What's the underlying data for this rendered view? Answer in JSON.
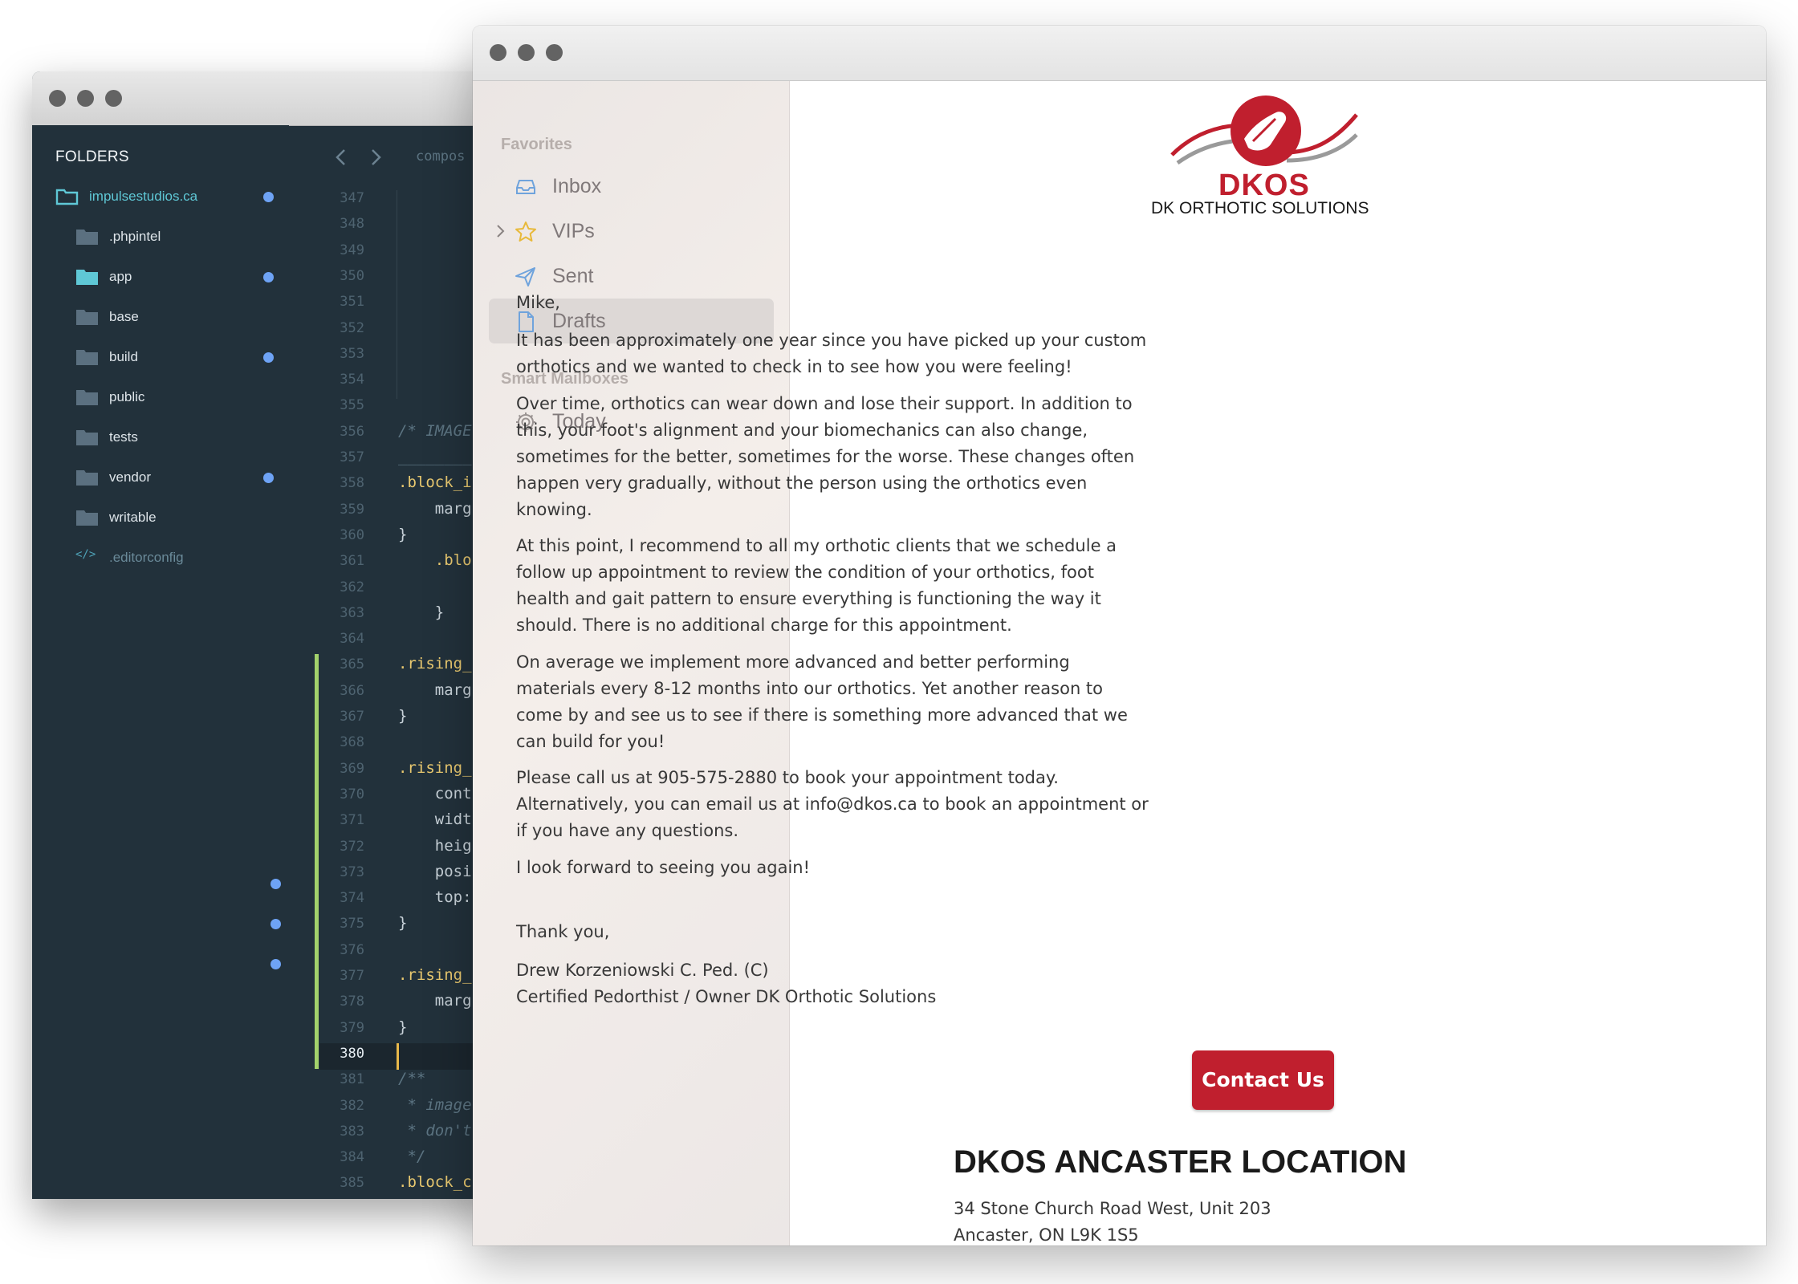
{
  "editor": {
    "folders_title": "FOLDERS",
    "tab_label": "compos",
    "tree": [
      {
        "label": "impulsestudios.ca",
        "modified": true
      },
      {
        "label": ".phpintel",
        "modified": false
      },
      {
        "label": "app",
        "modified": true
      },
      {
        "label": "base",
        "modified": false
      },
      {
        "label": "build",
        "modified": true
      },
      {
        "label": "public",
        "modified": false
      },
      {
        "label": "tests",
        "modified": false
      },
      {
        "label": "vendor",
        "modified": true
      },
      {
        "label": "writable",
        "modified": false
      },
      {
        "label": ".editorconfig",
        "modified": false
      }
    ],
    "line_numbers": [
      "347",
      "348",
      "349",
      "350",
      "351",
      "352",
      "353",
      "354",
      "355",
      "356",
      "357",
      "358",
      "359",
      "360",
      "361",
      "362",
      "363",
      "364",
      "365",
      "366",
      "367",
      "368",
      "369",
      "370",
      "371",
      "372",
      "373",
      "374",
      "375",
      "376",
      "377",
      "378",
      "379",
      "380",
      "381",
      "382",
      "383",
      "384",
      "385"
    ],
    "active_line": "380",
    "code_lines": [
      {
        "line": "356",
        "text": "/* IMAGE",
        "kind": "cmt"
      },
      {
        "line": "357",
        "text": "________",
        "kind": "cmt"
      },
      {
        "line": "358",
        "text": ".block_i",
        "kind": "sel"
      },
      {
        "line": "359",
        "text": "    marg",
        "kind": "plain"
      },
      {
        "line": "360",
        "text": "}",
        "kind": "plain"
      },
      {
        "line": "361",
        "text": "    .blo",
        "kind": "sel"
      },
      {
        "line": "362",
        "text": "        (",
        "kind": "plain"
      },
      {
        "line": "363",
        "text": "    }",
        "kind": "plain"
      },
      {
        "line": "365",
        "text": ".rising_",
        "kind": "sel"
      },
      {
        "line": "366",
        "text": "    marg",
        "kind": "plain"
      },
      {
        "line": "367",
        "text": "}",
        "kind": "plain"
      },
      {
        "line": "369",
        "text": ".rising_",
        "kind": "sel"
      },
      {
        "line": "370",
        "text": "    cont",
        "kind": "plain"
      },
      {
        "line": "371",
        "text": "    widt",
        "kind": "plain"
      },
      {
        "line": "372",
        "text": "    heig",
        "kind": "plain"
      },
      {
        "line": "373",
        "text": "    posi",
        "kind": "plain"
      },
      {
        "line": "374",
        "text": "    top:",
        "kind": "plain"
      },
      {
        "line": "375",
        "text": "}",
        "kind": "plain"
      },
      {
        "line": "377",
        "text": ".rising_",
        "kind": "sel"
      },
      {
        "line": "378",
        "text": "    marg",
        "kind": "plain"
      },
      {
        "line": "379",
        "text": "}",
        "kind": "plain"
      },
      {
        "line": "381",
        "text": "/**",
        "kind": "cmt"
      },
      {
        "line": "382",
        "text": " * image",
        "kind": "cmt"
      },
      {
        "line": "383",
        "text": " * don't",
        "kind": "cmt"
      },
      {
        "line": "384",
        "text": " */",
        "kind": "cmt"
      },
      {
        "line": "385",
        "text": ".block_c",
        "kind": "sel"
      }
    ]
  },
  "mail": {
    "sidebar": {
      "favorites_heading": "Favorites",
      "favorites": [
        {
          "label": "Inbox",
          "icon": "inbox-icon"
        },
        {
          "label": "VIPs",
          "icon": "star-icon"
        },
        {
          "label": "Sent",
          "icon": "paper-plane-icon"
        },
        {
          "label": "Drafts",
          "icon": "document-icon"
        }
      ],
      "smart_heading": "Smart Mailboxes",
      "smart": [
        {
          "label": "Today",
          "icon": "gear-icon"
        }
      ]
    },
    "message": {
      "logo_main": "DKOS",
      "logo_sub": "DK ORTHOTIC SOLUTIONS",
      "greeting": "Mike,",
      "paragraphs": [
        "It has been approximately one year since you have picked up your custom orthotics and we wanted to check in to see how you were feeling!",
        "Over time, orthotics can wear down and lose their support.  In addition to this, your foot's alignment and your biomechanics can also change, sometimes for the better, sometimes for the worse.  These changes often happen very gradually, without the person using the orthotics even knowing.",
        "At this point, I recommend to all my orthotic clients that we schedule a follow up appointment to review the condition of your orthotics, foot health and gait pattern to ensure everything is functioning the way it should. There is no additional charge for this appointment.",
        "On average we implement more advanced and better performing materials every 8-12 months into our orthotics.  Yet another reason to come by and see us to see if there is something more advanced that we can build for you!",
        "Please call us at 905-575-2880 to book your appointment today. Alternatively, you can email us at info@dkos.ca to book an appointment or if you have any questions.",
        "I look forward to seeing you again!"
      ],
      "closing": "Thank you,",
      "signature_name": "Drew Korzeniowski C. Ped. (C)",
      "signature_title": "Certified Pedorthist / Owner DK Orthotic Solutions",
      "cta_label": "Contact Us",
      "location_title": "DKOS ANCASTER LOCATION",
      "address_line1": "34 Stone Church Road West, Unit 203",
      "address_line2": "Ancaster, ON L9K 1S5"
    }
  },
  "colors": {
    "editor_bg": "#22313b",
    "accent_red": "#c01f2e",
    "modified_dot": "#6ea3f5",
    "git_gutter": "#a3d26b"
  }
}
